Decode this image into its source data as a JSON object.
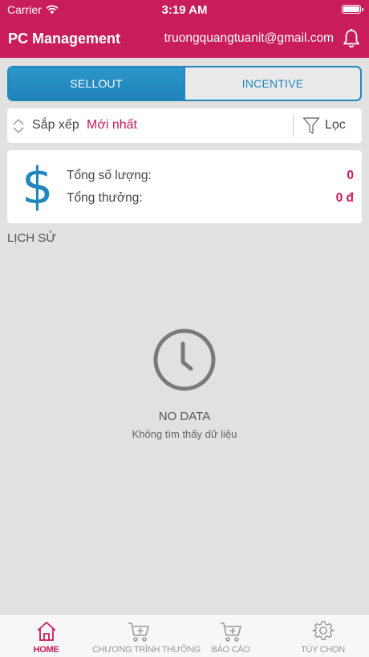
{
  "status_bar": {
    "carrier": "Carrier",
    "time": "3:19 AM"
  },
  "header": {
    "title": "PC Management",
    "email": "truongquangtuanit@gmail.com",
    "icon": "bell-icon"
  },
  "segment": {
    "tabs": [
      {
        "label": "SELLOUT",
        "active": true
      },
      {
        "label": "INCENTIVE",
        "active": false
      }
    ]
  },
  "sort": {
    "label": "Sắp xếp",
    "value": "Mới nhất"
  },
  "filter": {
    "label": "Lọc"
  },
  "summary": {
    "icon": "dollar-icon",
    "total_quantity_label": "Tổng số lượng:",
    "total_quantity_value": "0",
    "total_reward_label": "Tổng thưởng:",
    "total_reward_value": "0 đ"
  },
  "history": {
    "label": "LỊCH SỬ"
  },
  "empty_state": {
    "icon": "clock-icon",
    "title": "NO DATA",
    "subtitle": "Không tìm thấy dữ liệu"
  },
  "tabbar": {
    "items": [
      {
        "label": "HOME",
        "icon": "home-icon",
        "active": true
      },
      {
        "label": "CHƯƠNG TRÌNH THƯỞNG",
        "icon": "cart-icon",
        "active": false
      },
      {
        "label": "BÁO CÁO",
        "icon": "cart-icon",
        "active": false
      },
      {
        "label": "TÙY CHỌN",
        "icon": "gear-icon",
        "active": false
      }
    ]
  },
  "colors": {
    "brand": "#c81d5a",
    "accent": "#1f87bd",
    "background": "#e1e1e1"
  }
}
